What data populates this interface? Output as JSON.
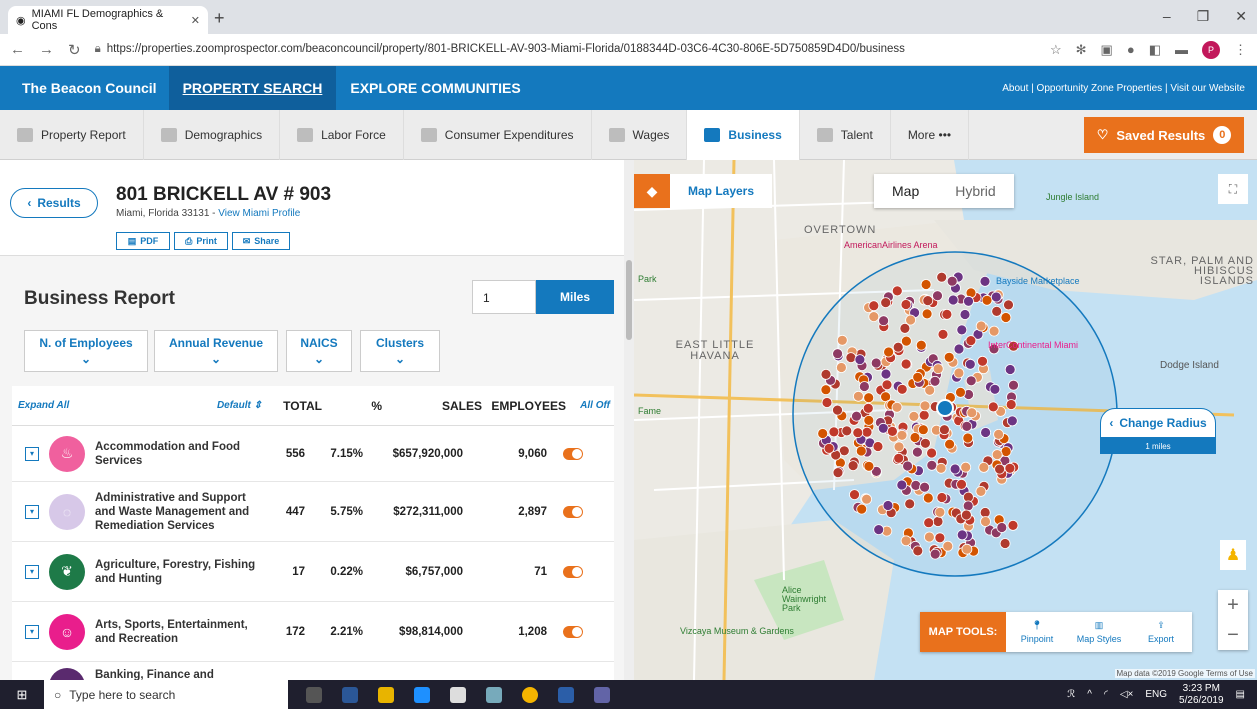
{
  "browser": {
    "tab_title": "MIAMI FL Demographics & Cons",
    "url": "https://properties.zoomprospector.com/beaconcouncil/property/801-BRICKELL-AV-903-Miami-Florida/0188344D-03C6-4C30-806E-5D750859D4D0/business",
    "profile": "P"
  },
  "site": {
    "brand": "The Beacon Council",
    "nav_property": "PROPERTY SEARCH",
    "nav_explore": "EXPLORE COMMUNITIES",
    "top_links": "About | Opportunity Zone Properties | Visit our Website"
  },
  "tabs": [
    "Property Report",
    "Demographics",
    "Labor Force",
    "Consumer Expenditures",
    "Wages",
    "Business",
    "Talent",
    "More •••"
  ],
  "saved": {
    "label": "Saved Results",
    "count": "0"
  },
  "property": {
    "results": "Results",
    "address": "801 BRICKELL AV # 903",
    "city": "Miami, Florida 33131 - ",
    "profile_link": "View Miami Profile",
    "pdf": "PDF",
    "print": "Print",
    "share": "Share",
    "expand_map": "Expand Map"
  },
  "report": {
    "title": "Business Report",
    "radius": "1",
    "unit": "Miles",
    "filters": [
      "N. of Employees",
      "Annual Revenue",
      "NAICS",
      "Clusters"
    ]
  },
  "table": {
    "expand_all": "Expand All",
    "default": "Default ⇕",
    "headers": [
      "TOTAL",
      "%",
      "SALES",
      "EMPLOYEES"
    ],
    "all_off": "All Off",
    "rows": [
      {
        "name": "Accommodation and Food Services",
        "total": "556",
        "pct": "7.15%",
        "sales": "$657,920,000",
        "employees": "9,060",
        "color": "#f0609e"
      },
      {
        "name": "Administrative and Support and Waste Management and Remediation Services",
        "total": "447",
        "pct": "5.75%",
        "sales": "$272,311,000",
        "employees": "2,897",
        "color": "#d7c8e8"
      },
      {
        "name": "Agriculture, Forestry, Fishing and Hunting",
        "total": "17",
        "pct": "0.22%",
        "sales": "$6,757,000",
        "employees": "71",
        "color": "#1e7a48"
      },
      {
        "name": "Arts, Sports, Entertainment, and Recreation",
        "total": "172",
        "pct": "2.21%",
        "sales": "$98,814,000",
        "employees": "1,208",
        "color": "#e91e8c"
      },
      {
        "name": "Banking, Finance and",
        "total": "",
        "pct": "",
        "sales": "",
        "employees": "",
        "color": "#5a2a6e"
      }
    ]
  },
  "map": {
    "layers": "Map Layers",
    "type_map": "Map",
    "type_hybrid": "Hybrid",
    "change_radius": "Change Radius",
    "radius_sub": "1 miles",
    "tools_label": "MAP TOOLS:",
    "tools": [
      "Pinpoint",
      "Map Styles",
      "Export"
    ],
    "attribution": "Map data ©2019 Google  Terms of Use",
    "places": [
      "OVERTOWN",
      "AmericanAirlines Arena",
      "Bayside Marketplace",
      "STAR, PALM AND HIBISCUS ISLANDS",
      "EAST LITTLE HAVANA",
      "InterContinental Miami",
      "Dodge Island",
      "Vizcaya Museum & Gardens",
      "Alice Wainwright Park",
      "Jungle Island",
      "Park",
      "Fame"
    ]
  },
  "taskbar": {
    "search": "Type here to search",
    "lang": "ENG",
    "time": "3:23 PM",
    "date": "5/26/2019"
  }
}
